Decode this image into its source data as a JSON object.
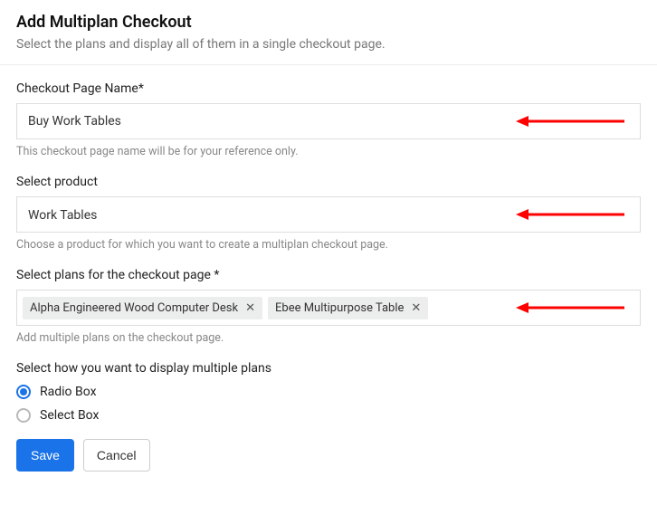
{
  "header": {
    "title": "Add Multiplan Checkout",
    "subtitle": "Select the plans and display all of them in a single checkout page."
  },
  "fields": {
    "name": {
      "label": "Checkout Page Name*",
      "value": "Buy Work Tables",
      "hint": "This checkout page name will be for your reference only."
    },
    "product": {
      "label": "Select product",
      "value": "Work Tables",
      "hint": "Choose a product for which you want to create a multiplan checkout page."
    },
    "plans": {
      "label": "Select plans for the checkout page *",
      "tags": [
        "Alpha Engineered Wood Computer Desk",
        "Ebee Multipurpose Table"
      ],
      "hint": "Add multiple plans on the checkout page."
    },
    "display": {
      "label": "Select how you want to display multiple plans",
      "options": [
        {
          "label": "Radio Box"
        },
        {
          "label": "Select Box"
        }
      ]
    }
  },
  "actions": {
    "save": "Save",
    "cancel": "Cancel"
  },
  "annotations": {
    "arrow_color": "#ff0000"
  }
}
